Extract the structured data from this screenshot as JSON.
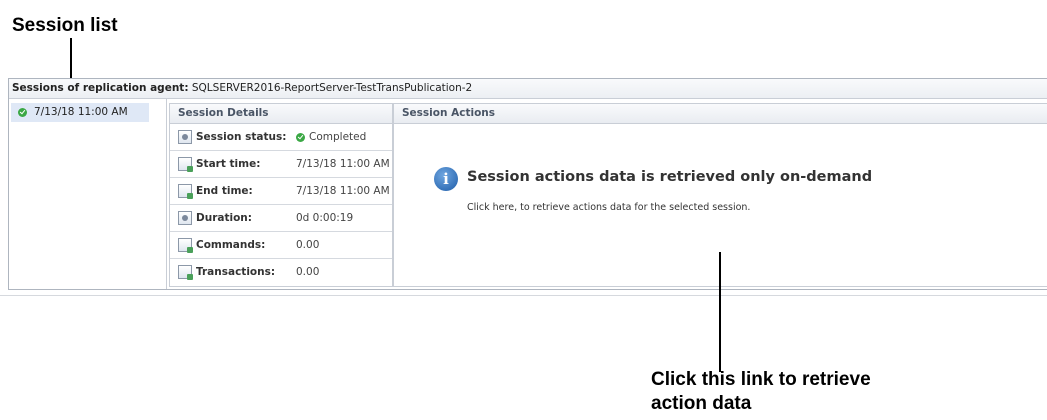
{
  "callouts": {
    "session_list": "Session list",
    "retrieve_link_line1": "Click this link to retrieve",
    "retrieve_link_line2": "action data"
  },
  "panel": {
    "header_label": "Sessions of replication agent:",
    "agent_name": "SQLSERVER2016-ReportServer-TestTransPublication-2"
  },
  "sessions": [
    {
      "label": "7/13/18 11:00 AM",
      "status_icon": "check-circle-icon",
      "status_color": "#3ba845"
    }
  ],
  "details": {
    "title": "Session Details",
    "rows": [
      {
        "label": "Session status:",
        "value": "Completed",
        "icon": "status-icon"
      },
      {
        "label": "Start time:",
        "value": "7/13/18 11:00 AM",
        "icon": "start-time-icon"
      },
      {
        "label": "End time:",
        "value": "7/13/18 11:00 AM",
        "icon": "end-time-icon"
      },
      {
        "label": "Duration:",
        "value": "0d 0:00:19",
        "icon": "duration-icon"
      },
      {
        "label": "Commands:",
        "value": "0.00",
        "icon": "commands-icon"
      },
      {
        "label": "Transactions:",
        "value": "0.00",
        "icon": "transactions-icon"
      }
    ]
  },
  "actions": {
    "title": "Session Actions",
    "message": "Session actions data is retrieved only on-demand",
    "link_text": "Click here, to retrieve actions data for the selected session.",
    "info_icon": "info-icon"
  }
}
